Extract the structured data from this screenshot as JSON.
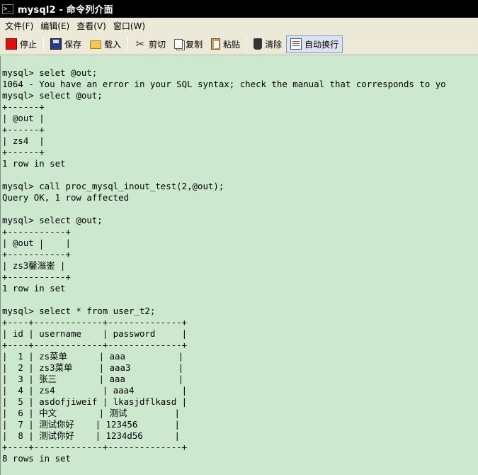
{
  "window": {
    "title": "mysql2 - 命令列介面",
    "icon": "console-icon"
  },
  "menu": [
    {
      "label": "文件(F)"
    },
    {
      "label": "编辑(E)"
    },
    {
      "label": "查看(V)"
    },
    {
      "label": "窗口(W)"
    }
  ],
  "toolbar": [
    {
      "label": "停止",
      "icon": "stop-icon"
    },
    {
      "label": "保存",
      "icon": "save-icon"
    },
    {
      "label": "载入",
      "icon": "folder-icon"
    },
    {
      "label": "剪切",
      "icon": "scissors-icon"
    },
    {
      "label": "复制",
      "icon": "copy-icon"
    },
    {
      "label": "粘贴",
      "icon": "paste-icon"
    },
    {
      "label": "清除",
      "icon": "trash-icon"
    },
    {
      "label": "自动换行",
      "icon": "wrap-icon",
      "active": true
    }
  ],
  "colors": {
    "console_bg": "#cce8cf",
    "title_bg": "#000000",
    "toolbar_bg": "#ece9d8"
  },
  "console": {
    "lines": [
      "mysql> selet @out;",
      "1064 - You have an error in your SQL syntax; check the manual that corresponds to yo",
      "mysql> select @out;",
      "+------+",
      "| @out |",
      "+------+",
      "| zs4  |",
      "+------+",
      "1 row in set",
      "",
      "mysql> call proc_mysql_inout_test(2,@out);",
      "Query OK, 1 row affected",
      "",
      "mysql> select @out;",
      "+-----------+",
      "| @out      |",
      "+-----------+",
      "| zs3鑿滃崟 |",
      "+-----------+",
      "1 row in set",
      "",
      "mysql> select * from user_t2;",
      "+----+-------------+--------------+",
      "| id | username    | password     |",
      "+----+-------------+--------------+",
      "|  1 | zs菜单      | aaa          |",
      "|  2 | zs3菜单     | aaa3         |",
      "|  3 | 张三        | aaa          |",
      "|  4 | zs4         | aaa4         |",
      "|  5 | asdofjiweif | lkasjdflkasd |",
      "|  6 | 中文        | 测试         |",
      "|  7 | 测试你好    | 123456       |",
      "|  8 | 测试你好    | 1234d56      |",
      "+----+-------------+--------------+",
      "8 rows in set"
    ]
  }
}
